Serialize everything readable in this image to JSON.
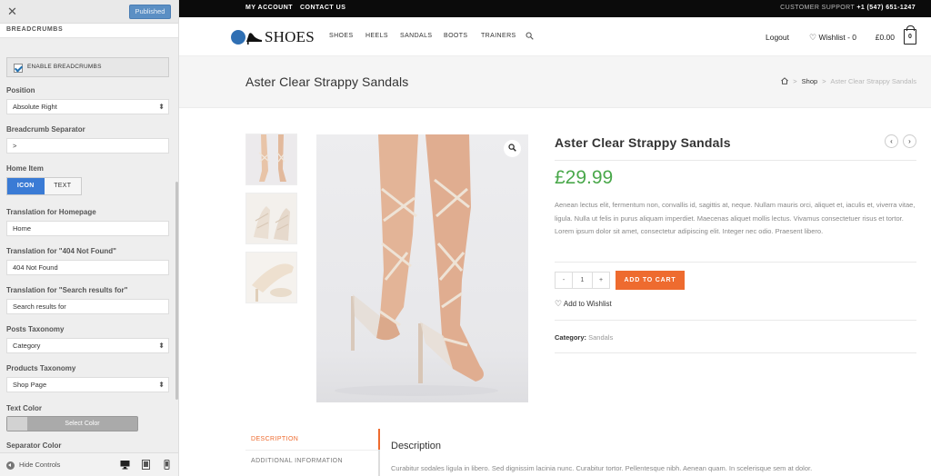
{
  "panel": {
    "close_label": "✕",
    "published_label": "Published",
    "section_title": "BREADCRUMBS",
    "enable_label": "ENABLE BREADCRUMBS",
    "enable_checked": true,
    "position_label": "Position",
    "position_value": "Absolute Right",
    "separator_label": "Breadcrumb Separator",
    "separator_value": ">",
    "home_item_label": "Home Item",
    "home_item_options": [
      "ICON",
      "TEXT"
    ],
    "home_item_selected": "ICON",
    "homepage_label": "Translation for Homepage",
    "homepage_value": "Home",
    "notfound_label": "Translation for \"404 Not Found\"",
    "notfound_value": "404 Not Found",
    "search_label": "Translation for \"Search results for\"",
    "search_value": "Search results for",
    "posts_tax_label": "Posts Taxonomy",
    "posts_tax_value": "Category",
    "products_tax_label": "Products Taxonomy",
    "products_tax_value": "Shop Page",
    "text_color_label": "Text Color",
    "select_color_label": "Select Color",
    "separator_color_label": "Separator Color",
    "hide_controls_label": "Hide Controls"
  },
  "site": {
    "topbar": {
      "my_account": "MY ACCOUNT",
      "contact_us": "CONTACT US",
      "support_label": "CUSTOMER SUPPORT",
      "support_phone": "+1 (547) 651-1247"
    },
    "logo_text": "SHOES",
    "nav": [
      "SHOES",
      "HEELS",
      "SANDALS",
      "BOOTS",
      "TRAINERS"
    ],
    "logout": "Logout",
    "wishlist": "Wishlist - 0",
    "cart_amount": "£0.00",
    "cart_count": "0",
    "page_title": "Aster Clear Strappy Sandals",
    "breadcrumbs": {
      "shop": "Shop",
      "separator": ">",
      "current": "Aster Clear Strappy Sandals"
    },
    "product": {
      "title": "Aster Clear Strappy Sandals",
      "price": "£29.99",
      "description": "Aenean lectus elit, fermentum non, convallis id, sagittis at, neque. Nullam mauris orci, aliquet et, iaculis et, viverra vitae, ligula. Nulla ut felis in purus aliquam imperdiet. Maecenas aliquet mollis lectus. Vivamus consectetuer risus et tortor. Lorem ipsum dolor sit amet, consectetur adipiscing elit. Integer nec odio. Praesent libero.",
      "qty_minus": "-",
      "qty_value": "1",
      "qty_plus": "+",
      "add_to_cart": "ADD TO CART",
      "add_to_wishlist": "Add to Wishlist",
      "category_label": "Category:",
      "category_value": "Sandals"
    },
    "tabs": [
      "DESCRIPTION",
      "ADDITIONAL INFORMATION"
    ],
    "tab_heading": "Description",
    "tab_text": "Curabitur sodales ligula in libero. Sed dignissim lacinia nunc. Curabitur tortor. Pellentesque nibh. Aenean quam. In scelerisque sem at dolor."
  },
  "colors": {
    "accent_orange": "#ee6b2f",
    "price_green": "#4aa84b",
    "toggle_blue": "#3a7bd5",
    "topbar_black": "#0b0b0b"
  }
}
